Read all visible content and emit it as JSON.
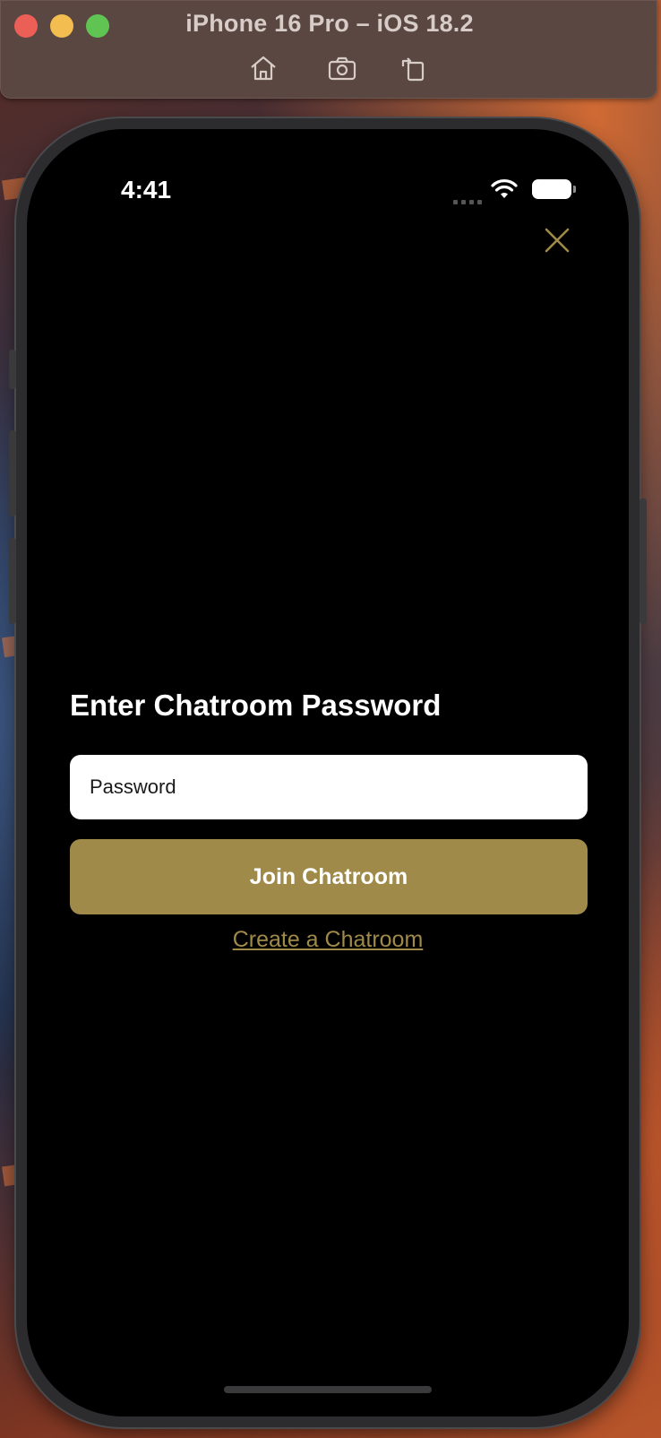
{
  "simulator": {
    "title": "iPhone 16 Pro – iOS 18.2",
    "toolbar": [
      "home-icon",
      "screenshot-icon",
      "rotate-icon"
    ]
  },
  "status_bar": {
    "time": "4:41"
  },
  "screen": {
    "heading": "Enter Chatroom Password",
    "password_placeholder": "Password",
    "password_value": "",
    "join_button": "Join Chatroom",
    "create_link": "Create a Chatroom"
  },
  "colors": {
    "accent": "#a08a4a",
    "background": "#000000",
    "input_background": "#ffffff"
  }
}
